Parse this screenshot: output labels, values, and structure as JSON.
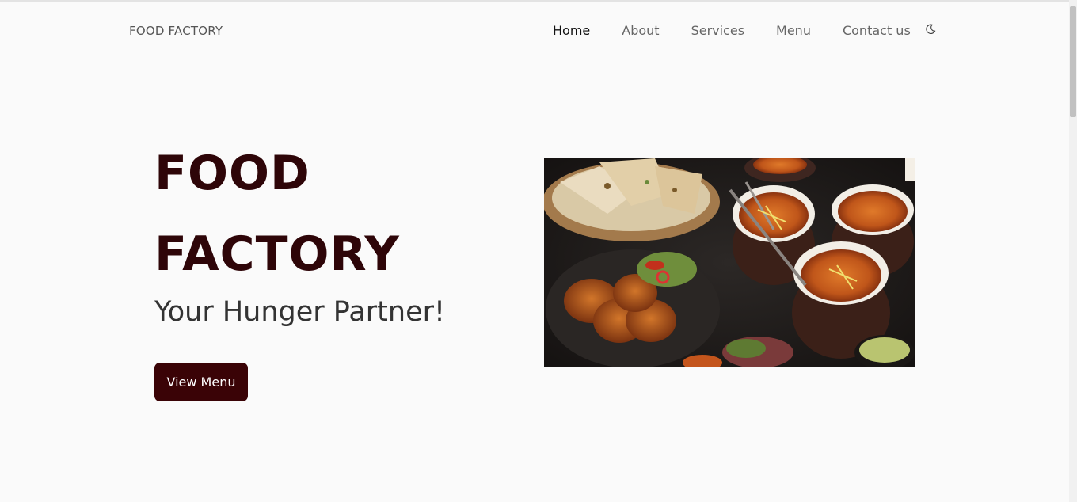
{
  "navbar": {
    "brand": "FOOD FACTORY",
    "links": [
      {
        "label": "Home",
        "active": true
      },
      {
        "label": "About",
        "active": false
      },
      {
        "label": "Services",
        "active": false
      },
      {
        "label": "Menu",
        "active": false
      },
      {
        "label": "Contact us",
        "active": false
      }
    ],
    "theme_toggle_icon": "moon-icon"
  },
  "hero": {
    "title_line1": "FOOD",
    "title_line2": "FACTORY",
    "tagline": "Your Hunger Partner!",
    "cta_label": "View Menu",
    "image_icon": "food-platter-image"
  },
  "colors": {
    "brand_dark": "#3a0306",
    "title_color": "#2e0508",
    "background": "#fafafa"
  }
}
